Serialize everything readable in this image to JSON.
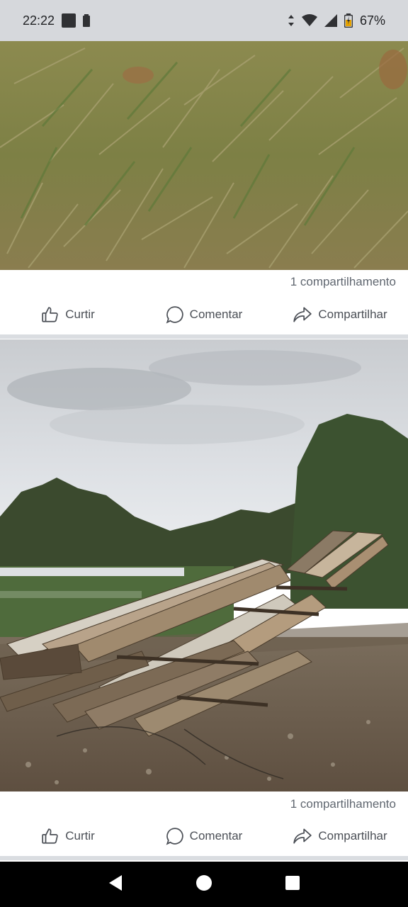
{
  "status_bar": {
    "time": "22:22",
    "battery_percent": "67%",
    "icons": [
      "notification-square-icon",
      "battery-small-icon",
      "data-arrows-icon",
      "wifi-icon",
      "signal-icon",
      "battery-icon"
    ]
  },
  "posts": [
    {
      "photo_icon": "grass-photo",
      "share_count": "1 compartilhamento",
      "actions": {
        "like": "Curtir",
        "comment": "Comentar",
        "share": "Compartilhar"
      }
    },
    {
      "photo_icon": "lumber-stack-photo",
      "share_count": "1 compartilhamento",
      "actions": {
        "like": "Curtir",
        "comment": "Comentar",
        "share": "Compartilhar"
      }
    }
  ],
  "nav_bar": {
    "icons": [
      "back-icon",
      "home-icon",
      "recents-icon"
    ]
  },
  "colors": {
    "status_bar_bg": "#d6d8dc",
    "text_muted": "#606770",
    "action_text": "#4b4f56",
    "divider": "#dadde1",
    "nav_bg": "#000000"
  }
}
